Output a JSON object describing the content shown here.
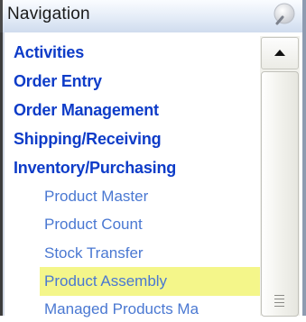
{
  "header": {
    "title": "Navigation",
    "button_icon": "search-icon"
  },
  "nav": {
    "items": [
      {
        "label": "Activities",
        "kind": "category"
      },
      {
        "label": "Order Entry",
        "kind": "category"
      },
      {
        "label": "Order Management",
        "kind": "category"
      },
      {
        "label": "Shipping/Receiving",
        "kind": "category"
      },
      {
        "label": "Inventory/Purchasing",
        "kind": "category"
      },
      {
        "label": "Product Master",
        "kind": "subitem"
      },
      {
        "label": "Product Count",
        "kind": "subitem"
      },
      {
        "label": "Stock Transfer",
        "kind": "subitem"
      },
      {
        "label": "Product Assembly",
        "kind": "subitem",
        "highlighted": true
      },
      {
        "label": "Managed Products Ma",
        "kind": "subitem"
      }
    ]
  },
  "colors": {
    "category": "#0e3cc8",
    "subitem": "#4a78d2",
    "highlight": "#f4f68a"
  }
}
